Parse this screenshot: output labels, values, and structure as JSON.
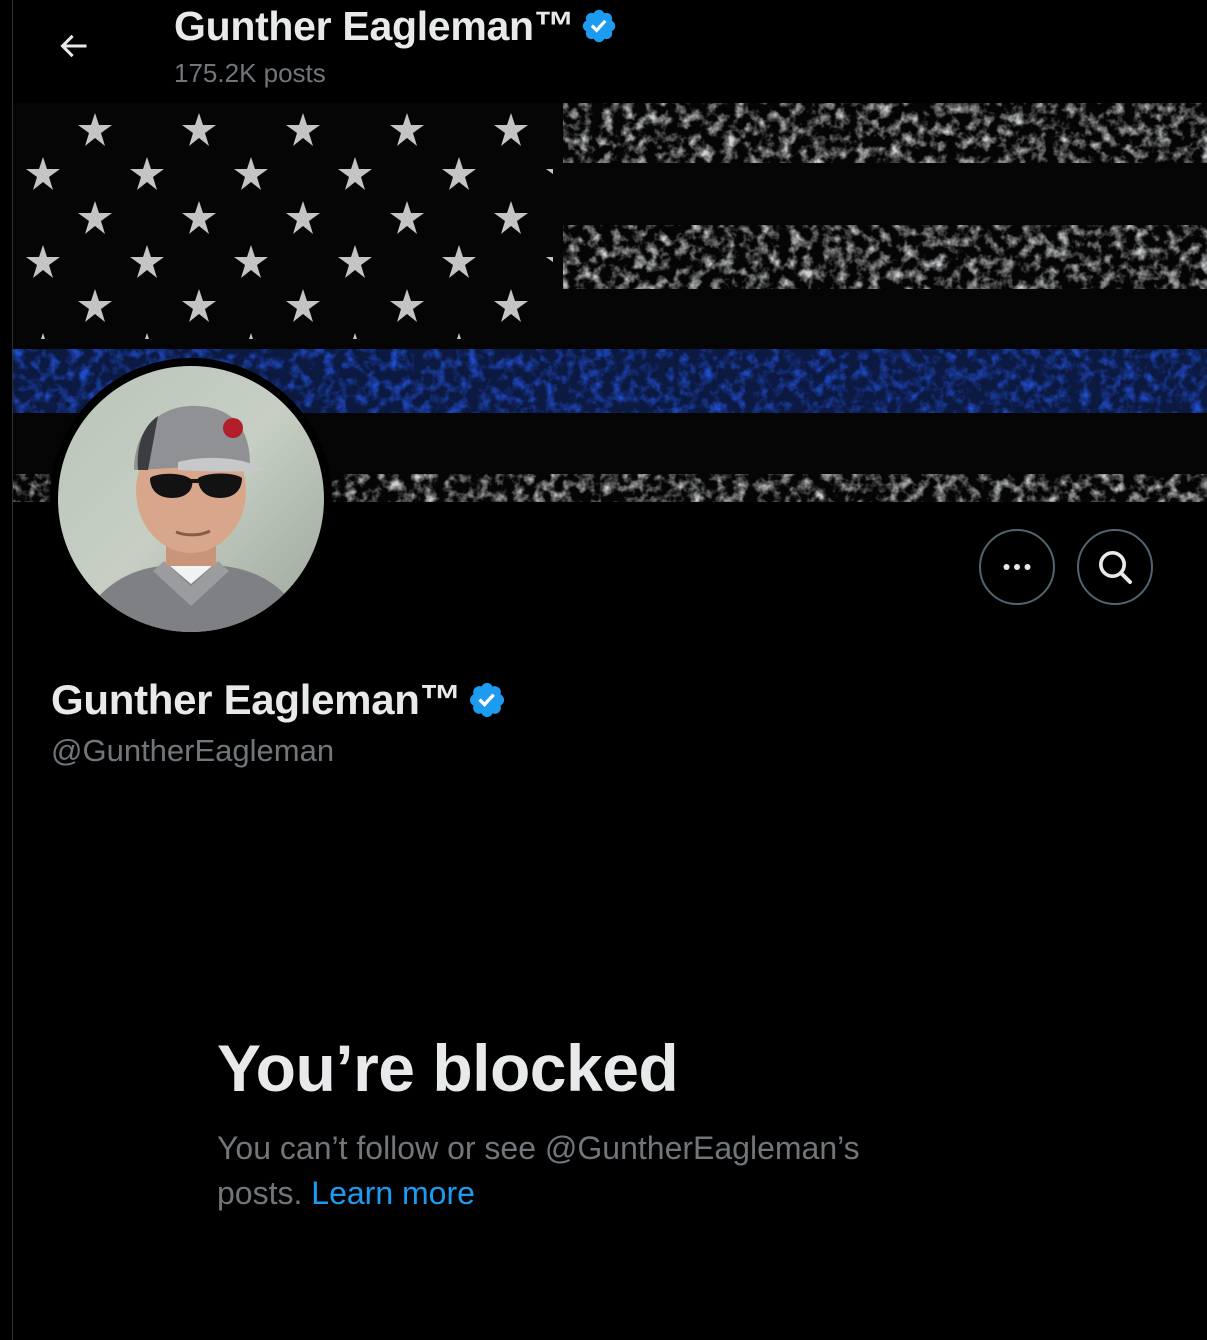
{
  "header": {
    "display_name": "Gunther Eagleman™",
    "post_count": "175.2K posts",
    "verified": true
  },
  "banner": {
    "description_colors": {
      "blue_line": "#1f4fd8",
      "stripe_light": "#c9cbcd",
      "background": "#000000"
    }
  },
  "profile": {
    "display_name": "Gunther Eagleman™",
    "handle": "@GuntherEagleman",
    "verified": true
  },
  "actions": {
    "more_icon": "more-icon",
    "search_icon": "search-icon"
  },
  "blocked": {
    "title": "You’re blocked",
    "body_text": "You can’t follow or see @GuntherEagleman’s posts.",
    "learn_more": "Learn more"
  },
  "colors": {
    "accent": "#1d9bf0",
    "verified_badge": "#1d9bf0",
    "secondary_text": "#71767b",
    "primary_text": "#e7e9ea"
  }
}
